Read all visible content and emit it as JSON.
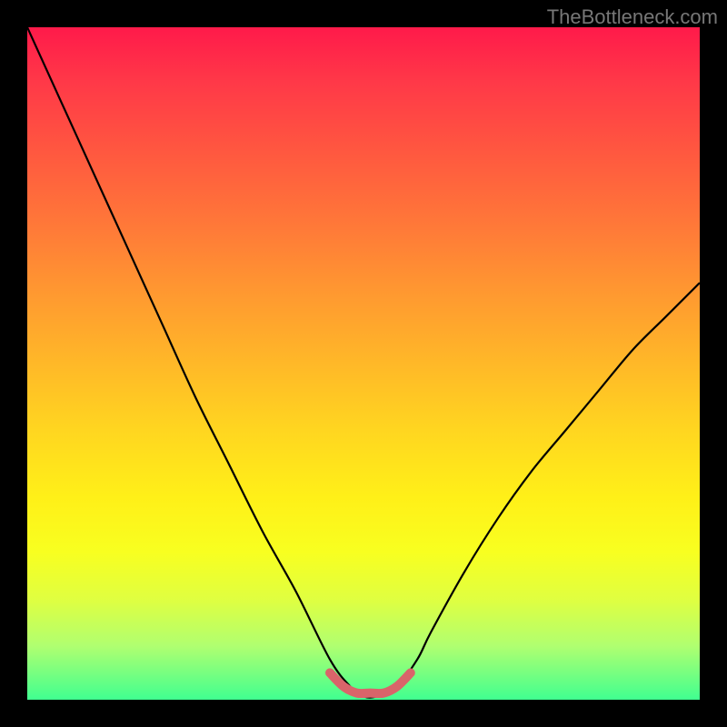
{
  "watermark": "TheBottleneck.com",
  "chart_data": {
    "type": "line",
    "title": "",
    "xlabel": "",
    "ylabel": "",
    "xlim": [
      0,
      100
    ],
    "ylim": [
      0,
      100
    ],
    "grid": false,
    "series": [
      {
        "name": "bottleneck-curve",
        "color": "#000000",
        "x": [
          0,
          5,
          10,
          15,
          20,
          25,
          30,
          35,
          40,
          45,
          48,
          50,
          52,
          55,
          58,
          60,
          65,
          70,
          75,
          80,
          85,
          90,
          95,
          100
        ],
        "values": [
          100,
          89,
          78,
          67,
          56,
          45,
          35,
          25,
          16,
          6,
          2,
          0.5,
          0.5,
          2,
          6,
          10,
          19,
          27,
          34,
          40,
          46,
          52,
          57,
          62
        ]
      },
      {
        "name": "safe-zone-marker",
        "color": "#d9646a",
        "x": [
          45,
          47,
          49,
          51,
          53,
          55,
          57
        ],
        "values": [
          4,
          2,
          1,
          1,
          1,
          2,
          4
        ]
      }
    ],
    "gradient_stops": [
      {
        "pos": 0,
        "color": "#ff1a4a"
      },
      {
        "pos": 18,
        "color": "#ff5640"
      },
      {
        "pos": 40,
        "color": "#ff9a30"
      },
      {
        "pos": 60,
        "color": "#ffd620"
      },
      {
        "pos": 78,
        "color": "#f8ff20"
      },
      {
        "pos": 92,
        "color": "#b0ff70"
      },
      {
        "pos": 100,
        "color": "#40ff90"
      }
    ]
  }
}
